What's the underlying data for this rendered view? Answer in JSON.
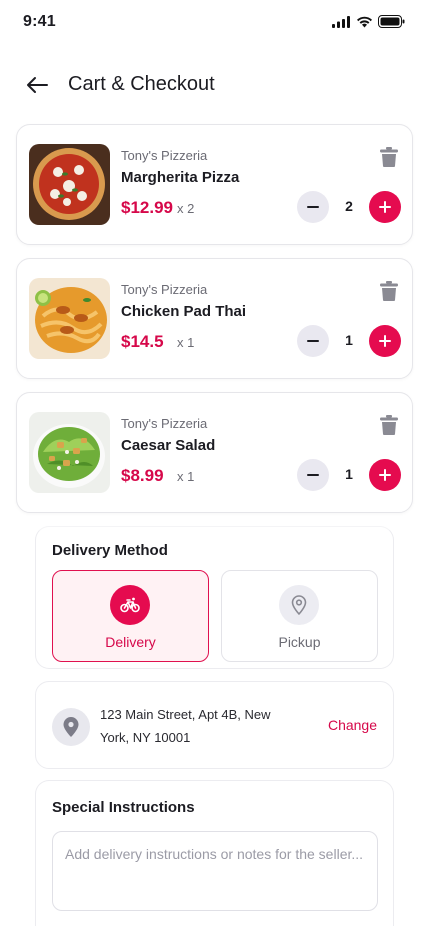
{
  "status_bar": {
    "time": "9:41"
  },
  "header": {
    "title": "Cart & Checkout"
  },
  "cart": {
    "items": [
      {
        "store": "Tony's Pizzeria",
        "name": "Margherita Pizza",
        "price": "$12.99",
        "qty_label": "x 2",
        "quantity": "2",
        "image": "margherita-pizza"
      },
      {
        "store": "Tony's Pizzeria",
        "name": "Chicken Pad Thai",
        "price": "$14.5",
        "qty_label": "x 1",
        "quantity": "1",
        "image": "chicken-pad-thai"
      },
      {
        "store": "Tony's Pizzeria",
        "name": "Caesar Salad",
        "price": "$8.99",
        "qty_label": "x 1",
        "quantity": "1",
        "image": "caesar-salad"
      }
    ]
  },
  "delivery_method": {
    "title": "Delivery Method",
    "options": [
      {
        "label": "Delivery",
        "icon": "bicycle-icon",
        "selected": true
      },
      {
        "label": "Pickup",
        "icon": "location-pin-icon",
        "selected": false
      }
    ]
  },
  "address": {
    "line1": "123 Main Street, Apt 4B, New",
    "line2": "York, NY 10001",
    "change_label": "Change"
  },
  "instructions": {
    "title": "Special Instructions",
    "placeholder": "Add delivery instructions or notes for the seller..."
  },
  "colors": {
    "accent": "#e50b4f",
    "price": "#d6084a",
    "selected_bg": "#fff2f4",
    "muted_button": "#e9e8f0"
  }
}
